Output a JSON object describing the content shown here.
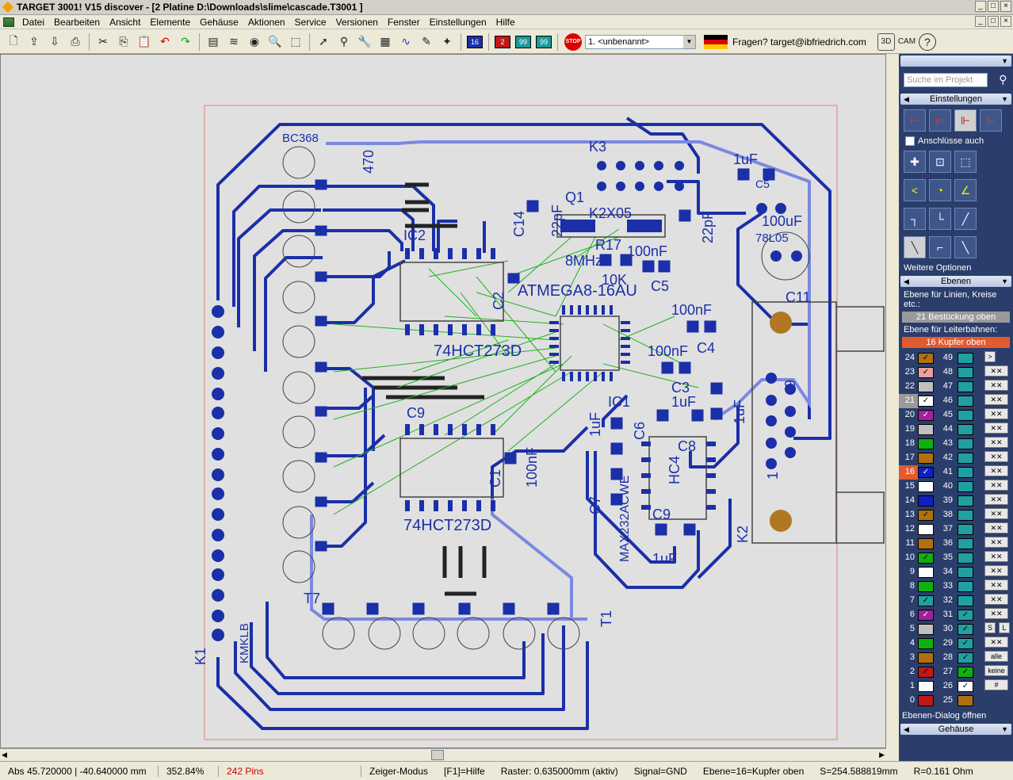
{
  "window": {
    "title": "TARGET 3001! V15 discover - [2 Platine D:\\Downloads\\slime\\cascade.T3001 ]"
  },
  "menu": [
    "Datei",
    "Bearbeiten",
    "Ansicht",
    "Elemente",
    "Gehäuse",
    "Aktionen",
    "Service",
    "Versionen",
    "Fenster",
    "Einstellungen",
    "Hilfe"
  ],
  "toolbar": {
    "layer_buttons": [
      {
        "label": "16",
        "color": "#1a2fa8"
      },
      {
        "label": "2",
        "color": "#c01818"
      },
      {
        "label": "99",
        "color": "#1a9a9a"
      },
      {
        "label": "99",
        "color": "#1a9a9a"
      }
    ],
    "stop_label": "STOP",
    "view_select": "1. <unbenannt>",
    "help_contact": "Fragen? target@ibfriedrich.com",
    "cam_label": "CAM",
    "threed_label": "3D"
  },
  "pcb": {
    "labels": [
      {
        "id": "bc368",
        "text": "BC368"
      },
      {
        "id": "k3",
        "text": "K3"
      },
      {
        "id": "q1",
        "text": "Q1"
      },
      {
        "id": "k2x05",
        "text": "K2X05"
      },
      {
        "id": "c14",
        "text": "C14"
      },
      {
        "id": "c22pf1",
        "text": "22pF"
      },
      {
        "id": "c22pf2",
        "text": "22pF"
      },
      {
        "id": "c1uf1",
        "text": "1uF"
      },
      {
        "id": "c5x",
        "text": "C5"
      },
      {
        "id": "c100uf",
        "text": "100uF"
      },
      {
        "id": "l78l05",
        "text": "78L05"
      },
      {
        "id": "ic2",
        "text": "IC2"
      },
      {
        "id": "mhz",
        "text": "8MHz"
      },
      {
        "id": "r17",
        "text": "R17"
      },
      {
        "id": "c100nf1",
        "text": "100nF"
      },
      {
        "id": "atmega",
        "text": "ATMEGA8-16AU"
      },
      {
        "id": "k10",
        "text": "10K"
      },
      {
        "id": "c5",
        "text": "C5"
      },
      {
        "id": "c100nf2",
        "text": "100nF"
      },
      {
        "id": "c4",
        "text": "C4"
      },
      {
        "id": "c100nf3",
        "text": "100nF"
      },
      {
        "id": "c3",
        "text": "C3"
      },
      {
        "id": "c1uf2",
        "text": "1uF"
      },
      {
        "id": "c11",
        "text": "C11"
      },
      {
        "id": "hct1",
        "text": "74HCT273D"
      },
      {
        "id": "c2",
        "text": "C2"
      },
      {
        "id": "hct2",
        "text": "74HCT273D"
      },
      {
        "id": "c9x",
        "text": "C9"
      },
      {
        "id": "c1",
        "text": "C1"
      },
      {
        "id": "c100nf4",
        "text": "100nF"
      },
      {
        "id": "ic1",
        "text": "IC1"
      },
      {
        "id": "c6",
        "text": "C6"
      },
      {
        "id": "c8",
        "text": "C8"
      },
      {
        "id": "hc4",
        "text": "HC4"
      },
      {
        "id": "c7",
        "text": "C7"
      },
      {
        "id": "c9",
        "text": "C9"
      },
      {
        "id": "c1uf3",
        "text": "1uF"
      },
      {
        "id": "max",
        "text": "MAX232ACWE"
      },
      {
        "id": "k2",
        "text": "K2"
      },
      {
        "id": "k1",
        "text": "K1"
      },
      {
        "id": "kl",
        "text": "KMKLB"
      },
      {
        "id": "t7",
        "text": "T7"
      },
      {
        "id": "t1",
        "text": "T1"
      },
      {
        "id": "r470",
        "text": "470"
      },
      {
        "id": "n9",
        "text": "9"
      },
      {
        "id": "n1",
        "text": "1"
      },
      {
        "id": "c1uf4",
        "text": "1uF"
      },
      {
        "id": "c1uf5",
        "text": "1uF"
      }
    ]
  },
  "panel": {
    "search_placeholder": "Suche im Projekt",
    "settings_head": "Einstellungen",
    "connections_label": "Anschlüsse auch",
    "more_options": "Weitere Optionen",
    "layers_head": "Ebenen",
    "layer_for_lines": "Ebene für Linien, Kreise etc.:",
    "layer_lines_value": "21 Bestückung oben",
    "layer_for_tracks": "Ebene für Leiterbahnen:",
    "layer_tracks_value": "16 Kupfer oben",
    "open_dialog": "Ebenen-Dialog öffnen",
    "housing_head": "Gehäuse",
    "btn_all": "alle",
    "btn_none": "keine",
    "btn_s": "S",
    "btn_l": "L",
    "btn_hash": "#",
    "btn_next": ">",
    "layers_left": [
      {
        "num": "24",
        "color": "#b07010",
        "checked": true
      },
      {
        "num": "23",
        "color": "#e8a0a0",
        "checked": true
      },
      {
        "num": "22",
        "color": "#c0c0c0",
        "checked": false
      },
      {
        "num": "21",
        "color": "#ffffff",
        "checked": true
      },
      {
        "num": "20",
        "color": "#a020a0",
        "checked": true
      },
      {
        "num": "19",
        "color": "#c0c0c0",
        "checked": false
      },
      {
        "num": "18",
        "color": "#10b010",
        "checked": false
      },
      {
        "num": "17",
        "color": "#b07010",
        "checked": false
      },
      {
        "num": "16",
        "color": "#1020c0",
        "checked": true
      },
      {
        "num": "15",
        "color": "#ffffff",
        "checked": false
      },
      {
        "num": "14",
        "color": "#1020c0",
        "checked": false
      },
      {
        "num": "13",
        "color": "#b07010",
        "checked": true
      },
      {
        "num": "12",
        "color": "#ffffff",
        "checked": false
      },
      {
        "num": "11",
        "color": "#b07010",
        "checked": false
      },
      {
        "num": "10",
        "color": "#10b010",
        "checked": true
      },
      {
        "num": "9",
        "color": "#ffffff",
        "checked": false
      },
      {
        "num": "8",
        "color": "#10b010",
        "checked": false
      },
      {
        "num": "7",
        "color": "#20a0a0",
        "checked": true
      },
      {
        "num": "6",
        "color": "#a020a0",
        "checked": true
      },
      {
        "num": "5",
        "color": "#c0c0c0",
        "checked": false
      },
      {
        "num": "4",
        "color": "#10b010",
        "checked": false
      },
      {
        "num": "3",
        "color": "#b07010",
        "checked": false
      },
      {
        "num": "2",
        "color": "#c01818",
        "checked": true
      },
      {
        "num": "1",
        "color": "#ffffff",
        "checked": false
      },
      {
        "num": "0",
        "color": "#c01818",
        "checked": false
      }
    ],
    "layers_right": [
      {
        "num": "49",
        "color": "#20a0a0",
        "checked": false
      },
      {
        "num": "48",
        "color": "#20a0a0",
        "checked": false
      },
      {
        "num": "47",
        "color": "#20a0a0",
        "checked": false
      },
      {
        "num": "46",
        "color": "#20a0a0",
        "checked": false
      },
      {
        "num": "45",
        "color": "#20a0a0",
        "checked": false
      },
      {
        "num": "44",
        "color": "#20a0a0",
        "checked": false
      },
      {
        "num": "43",
        "color": "#20a0a0",
        "checked": false
      },
      {
        "num": "42",
        "color": "#20a0a0",
        "checked": false
      },
      {
        "num": "41",
        "color": "#20a0a0",
        "checked": false
      },
      {
        "num": "40",
        "color": "#20a0a0",
        "checked": false
      },
      {
        "num": "39",
        "color": "#20a0a0",
        "checked": false
      },
      {
        "num": "38",
        "color": "#20a0a0",
        "checked": false
      },
      {
        "num": "37",
        "color": "#20a0a0",
        "checked": false
      },
      {
        "num": "36",
        "color": "#20a0a0",
        "checked": false
      },
      {
        "num": "35",
        "color": "#20a0a0",
        "checked": false
      },
      {
        "num": "34",
        "color": "#20a0a0",
        "checked": false
      },
      {
        "num": "33",
        "color": "#20a0a0",
        "checked": false
      },
      {
        "num": "32",
        "color": "#20a0a0",
        "checked": false
      },
      {
        "num": "31",
        "color": "#20a0a0",
        "checked": true
      },
      {
        "num": "30",
        "color": "#20a0a0",
        "checked": true
      },
      {
        "num": "29",
        "color": "#20a0a0",
        "checked": true
      },
      {
        "num": "28",
        "color": "#20a0a0",
        "checked": true
      },
      {
        "num": "27",
        "color": "#10b010",
        "checked": true
      },
      {
        "num": "26",
        "color": "#ffffff",
        "checked": true
      },
      {
        "num": "25",
        "color": "#b07010",
        "checked": false
      }
    ]
  },
  "status": {
    "abs": "Abs 45.720000 | -40.640000 mm",
    "zoom": "352.84%",
    "pins": "242 Pins",
    "mode": "Zeiger-Modus",
    "help": "[F1]=Hilfe",
    "raster": "Raster: 0.635000mm (aktiv)",
    "signal": "Signal=GND",
    "layer": "Ebene=16=Kupfer oben",
    "s": "S=254.588819mm",
    "r": "R=0.161 Ohm"
  }
}
